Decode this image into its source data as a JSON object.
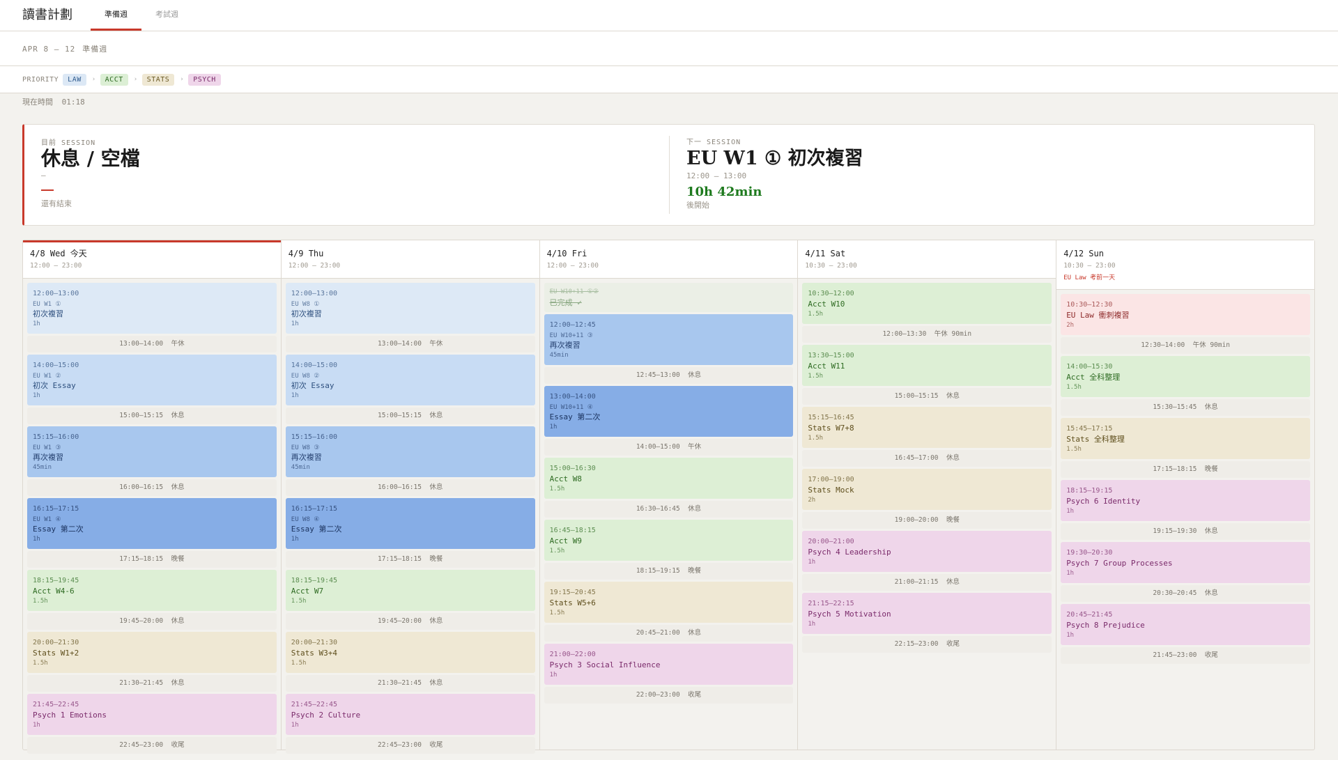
{
  "app": {
    "title": "讀書計劃",
    "tabs": [
      {
        "label": "準備週",
        "active": true
      },
      {
        "label": "考試週",
        "active": false
      }
    ]
  },
  "subheader": {
    "range": "APR 8 — 12",
    "week": "準備週"
  },
  "priority": {
    "label": "PRIORITY",
    "items": [
      {
        "label": "LAW",
        "bg": "#dce8f5",
        "fg": "#2d5a8e"
      },
      {
        "label": "ACCT",
        "bg": "#dcefd5",
        "fg": "#2e6b22"
      },
      {
        "label": "STATS",
        "bg": "#efe8d4",
        "fg": "#6b5a24"
      },
      {
        "label": "PSYCH",
        "bg": "#efd6ea",
        "fg": "#7a2a6a"
      }
    ],
    "sep": "›"
  },
  "now": {
    "label": "現在時間",
    "time": "01:18"
  },
  "current": {
    "label": "目前 SESSION",
    "title": "休息 / 空檔",
    "sub": "—",
    "remain": "還有結束"
  },
  "next": {
    "label": "下一 SESSION",
    "title": "EU W1 ① 初次複習",
    "time": "12:00 — 13:00",
    "countdown": "10h 42min",
    "after": "後開始"
  },
  "colors": {
    "law1": [
      "#dde9f6",
      "#2d4f7e"
    ],
    "law2": [
      "#c8dcf4",
      "#2d4f7e"
    ],
    "law3": [
      "#a8c7ee",
      "#243f6e"
    ],
    "law4": [
      "#86ade6",
      "#1c3460"
    ],
    "acct": [
      "#ddefd5",
      "#2e6b22"
    ],
    "stats": [
      "#efe8d4",
      "#5e4e1c"
    ],
    "psych": [
      "#efd6ea",
      "#7a2a6a"
    ],
    "lawred": [
      "#fbe5e5",
      "#8e2a2a"
    ]
  },
  "days": [
    {
      "date": "4/8 Wed 今天",
      "hours": "12:00 — 23:00",
      "today": true,
      "items": [
        {
          "k": "s",
          "c": "law1",
          "time": "12:00–13:00",
          "tag": "EU W1 ①",
          "title": "初次複習",
          "dur": "1h"
        },
        {
          "k": "b",
          "text": "13:00–14:00  午休"
        },
        {
          "k": "s",
          "c": "law2",
          "time": "14:00–15:00",
          "tag": "EU W1 ②",
          "title": "初次 Essay",
          "dur": "1h"
        },
        {
          "k": "b",
          "text": "15:00–15:15  休息"
        },
        {
          "k": "s",
          "c": "law3",
          "time": "15:15–16:00",
          "tag": "EU W1 ③",
          "title": "再次複習",
          "dur": "45min"
        },
        {
          "k": "b",
          "text": "16:00–16:15  休息"
        },
        {
          "k": "s",
          "c": "law4",
          "time": "16:15–17:15",
          "tag": "EU W1 ④",
          "title": "Essay 第二次",
          "dur": "1h"
        },
        {
          "k": "b",
          "text": "17:15–18:15  晚餐"
        },
        {
          "k": "s",
          "c": "acct",
          "time": "18:15–19:45",
          "title": "Acct W4-6",
          "dur": "1.5h"
        },
        {
          "k": "b",
          "text": "19:45–20:00  休息"
        },
        {
          "k": "s",
          "c": "stats",
          "time": "20:00–21:30",
          "title": "Stats W1+2",
          "dur": "1.5h"
        },
        {
          "k": "b",
          "text": "21:30–21:45  休息"
        },
        {
          "k": "s",
          "c": "psych",
          "time": "21:45–22:45",
          "title": "Psych 1 Emotions",
          "dur": "1h"
        },
        {
          "k": "b",
          "text": "22:45–23:00  收尾"
        }
      ]
    },
    {
      "date": "4/9 Thu",
      "hours": "12:00 — 23:00",
      "items": [
        {
          "k": "s",
          "c": "law1",
          "time": "12:00–13:00",
          "tag": "EU W8 ①",
          "title": "初次複習",
          "dur": "1h"
        },
        {
          "k": "b",
          "text": "13:00–14:00  午休"
        },
        {
          "k": "s",
          "c": "law2",
          "time": "14:00–15:00",
          "tag": "EU W8 ②",
          "title": "初次 Essay",
          "dur": "1h"
        },
        {
          "k": "b",
          "text": "15:00–15:15  休息"
        },
        {
          "k": "s",
          "c": "law3",
          "time": "15:15–16:00",
          "tag": "EU W8 ③",
          "title": "再次複習",
          "dur": "45min"
        },
        {
          "k": "b",
          "text": "16:00–16:15  休息"
        },
        {
          "k": "s",
          "c": "law4",
          "time": "16:15–17:15",
          "tag": "EU W8 ④",
          "title": "Essay 第二次",
          "dur": "1h"
        },
        {
          "k": "b",
          "text": "17:15–18:15  晚餐"
        },
        {
          "k": "s",
          "c": "acct",
          "time": "18:15–19:45",
          "title": "Acct W7",
          "dur": "1.5h"
        },
        {
          "k": "b",
          "text": "19:45–20:00  休息"
        },
        {
          "k": "s",
          "c": "stats",
          "time": "20:00–21:30",
          "title": "Stats W3+4",
          "dur": "1.5h"
        },
        {
          "k": "b",
          "text": "21:30–21:45  休息"
        },
        {
          "k": "s",
          "c": "psych",
          "time": "21:45–22:45",
          "title": "Psych 2 Culture",
          "dur": "1h"
        },
        {
          "k": "b",
          "text": "22:45–23:00  收尾"
        }
      ]
    },
    {
      "date": "4/10 Fri",
      "hours": "12:00 — 23:00",
      "items": [
        {
          "k": "d",
          "tag": "EU W10+11 ①②",
          "title": "已完成 ✓"
        },
        {
          "k": "s",
          "c": "law3",
          "time": "12:00–12:45",
          "tag": "EU W10+11 ③",
          "title": "再次複習",
          "dur": "45min"
        },
        {
          "k": "b",
          "text": "12:45–13:00  休息"
        },
        {
          "k": "s",
          "c": "law4",
          "time": "13:00–14:00",
          "tag": "EU W10+11 ④",
          "title": "Essay 第二次",
          "dur": "1h"
        },
        {
          "k": "b",
          "text": "14:00–15:00  午休"
        },
        {
          "k": "s",
          "c": "acct",
          "time": "15:00–16:30",
          "title": "Acct W8",
          "dur": "1.5h"
        },
        {
          "k": "b",
          "text": "16:30–16:45  休息"
        },
        {
          "k": "s",
          "c": "acct",
          "time": "16:45–18:15",
          "title": "Acct W9",
          "dur": "1.5h"
        },
        {
          "k": "b",
          "text": "18:15–19:15  晚餐"
        },
        {
          "k": "s",
          "c": "stats",
          "time": "19:15–20:45",
          "title": "Stats W5+6",
          "dur": "1.5h"
        },
        {
          "k": "b",
          "text": "20:45–21:00  休息"
        },
        {
          "k": "s",
          "c": "psych",
          "time": "21:00–22:00",
          "title": "Psych 3 Social Influence",
          "dur": "1h"
        },
        {
          "k": "b",
          "text": "22:00–23:00  收尾"
        }
      ]
    },
    {
      "date": "4/11 Sat",
      "hours": "10:30 — 23:00",
      "items": [
        {
          "k": "s",
          "c": "acct",
          "time": "10:30–12:00",
          "title": "Acct W10",
          "dur": "1.5h"
        },
        {
          "k": "b",
          "text": "12:00–13:30  午休 90min"
        },
        {
          "k": "s",
          "c": "acct",
          "time": "13:30–15:00",
          "title": "Acct W11",
          "dur": "1.5h"
        },
        {
          "k": "b",
          "text": "15:00–15:15  休息"
        },
        {
          "k": "s",
          "c": "stats",
          "time": "15:15–16:45",
          "title": "Stats W7+8",
          "dur": "1.5h"
        },
        {
          "k": "b",
          "text": "16:45–17:00  休息"
        },
        {
          "k": "s",
          "c": "stats",
          "time": "17:00–19:00",
          "title": "Stats Mock",
          "dur": "2h"
        },
        {
          "k": "b",
          "text": "19:00–20:00  晚餐"
        },
        {
          "k": "s",
          "c": "psych",
          "time": "20:00–21:00",
          "title": "Psych 4 Leadership",
          "dur": "1h"
        },
        {
          "k": "b",
          "text": "21:00–21:15  休息"
        },
        {
          "k": "s",
          "c": "psych",
          "time": "21:15–22:15",
          "title": "Psych 5 Motivation",
          "dur": "1h"
        },
        {
          "k": "b",
          "text": "22:15–23:00  收尾"
        }
      ]
    },
    {
      "date": "4/12 Sun",
      "hours": "10:30 — 23:00",
      "note": "EU Law 考前一天",
      "items": [
        {
          "k": "s",
          "c": "lawred",
          "time": "10:30–12:30",
          "title": "EU Law 衝刺複習",
          "dur": "2h"
        },
        {
          "k": "b",
          "text": "12:30–14:00  午休 90min"
        },
        {
          "k": "s",
          "c": "acct",
          "time": "14:00–15:30",
          "title": "Acct 全科整理",
          "dur": "1.5h"
        },
        {
          "k": "b",
          "text": "15:30–15:45  休息"
        },
        {
          "k": "s",
          "c": "stats",
          "time": "15:45–17:15",
          "title": "Stats 全科整理",
          "dur": "1.5h"
        },
        {
          "k": "b",
          "text": "17:15–18:15  晚餐"
        },
        {
          "k": "s",
          "c": "psych",
          "time": "18:15–19:15",
          "title": "Psych 6 Identity",
          "dur": "1h"
        },
        {
          "k": "b",
          "text": "19:15–19:30  休息"
        },
        {
          "k": "s",
          "c": "psych",
          "time": "19:30–20:30",
          "title": "Psych 7 Group Processes",
          "dur": "1h"
        },
        {
          "k": "b",
          "text": "20:30–20:45  休息"
        },
        {
          "k": "s",
          "c": "psych",
          "time": "20:45–21:45",
          "title": "Psych 8 Prejudice",
          "dur": "1h"
        },
        {
          "k": "b",
          "text": "21:45–23:00  收尾"
        }
      ]
    }
  ]
}
